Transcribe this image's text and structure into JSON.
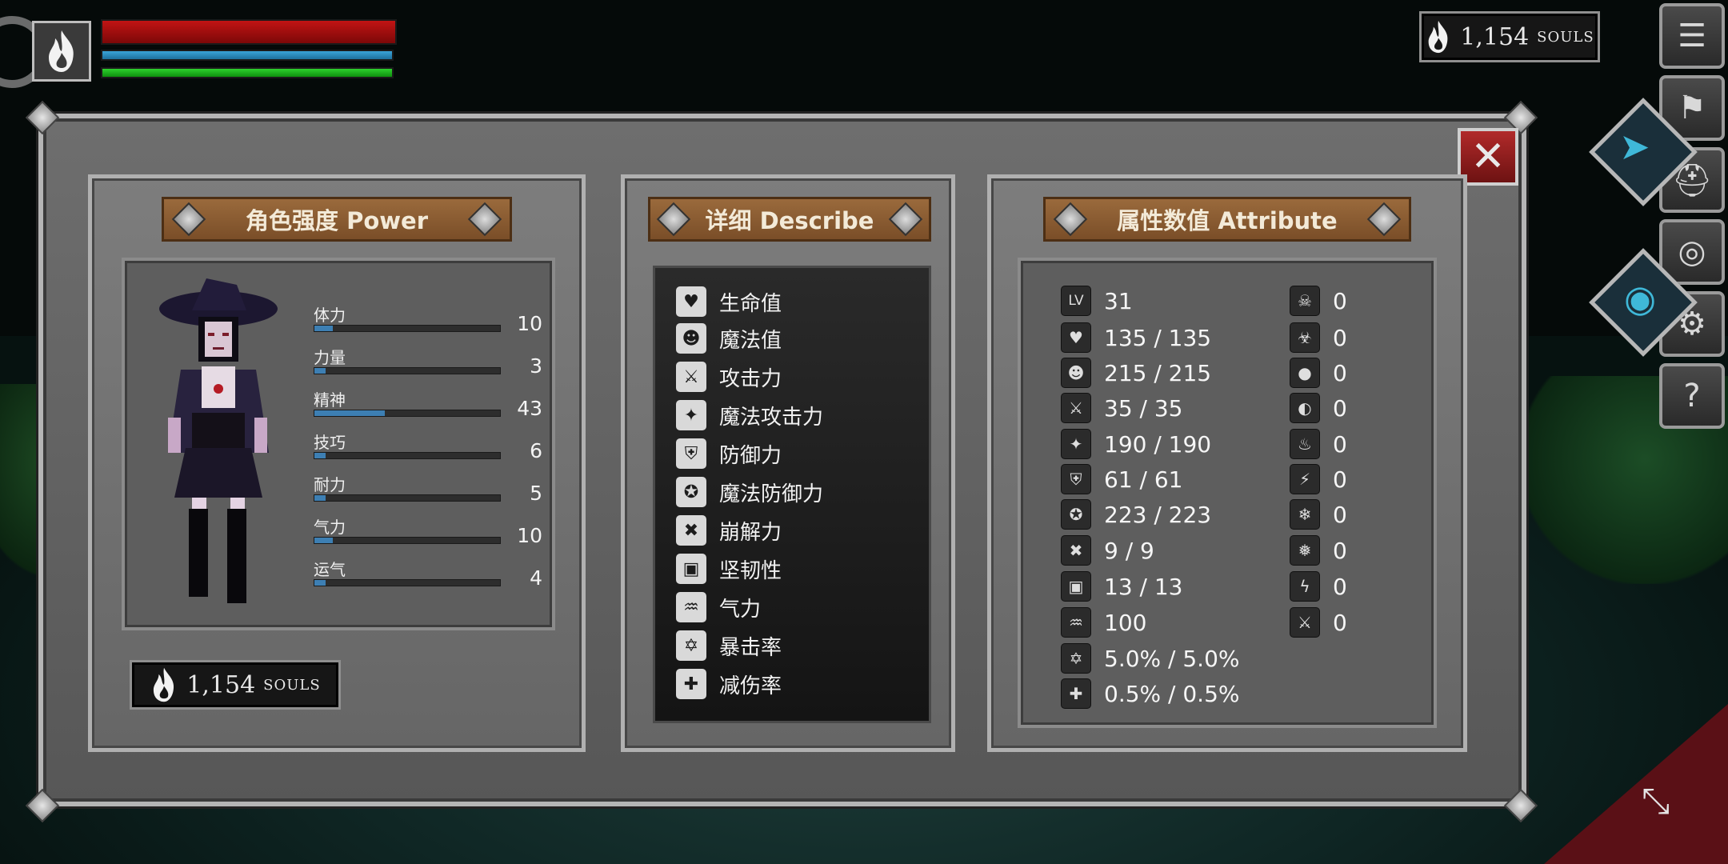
{
  "hud": {
    "souls_value": "1,154",
    "souls_label": "SOULS"
  },
  "power": {
    "title": "角色强度 Power",
    "stats": [
      {
        "name": "体力",
        "value": "10",
        "fill": 0.1
      },
      {
        "name": "力量",
        "value": "3",
        "fill": 0.03
      },
      {
        "name": "精神",
        "value": "43",
        "fill": 0.38
      },
      {
        "name": "技巧",
        "value": "6",
        "fill": 0.06
      },
      {
        "name": "耐力",
        "value": "5",
        "fill": 0.05
      },
      {
        "name": "气力",
        "value": "10",
        "fill": 0.1
      },
      {
        "name": "运气",
        "value": "4",
        "fill": 0.04
      }
    ],
    "souls_value": "1,154",
    "souls_label": "SOULS"
  },
  "describe": {
    "title": "详细 Describe",
    "items": [
      {
        "label": "生命值",
        "icon": "heart-icon",
        "glyph": "♥"
      },
      {
        "label": "魔法值",
        "icon": "head-icon",
        "glyph": "☻"
      },
      {
        "label": "攻击力",
        "icon": "sword-icon",
        "glyph": "⚔"
      },
      {
        "label": "魔法攻击力",
        "icon": "spellbook-icon",
        "glyph": "✦"
      },
      {
        "label": "防御力",
        "icon": "shield-icon",
        "glyph": "⛨"
      },
      {
        "label": "魔法防御力",
        "icon": "magic-shield-icon",
        "glyph": "✪"
      },
      {
        "label": "崩解力",
        "icon": "break-icon",
        "glyph": "✖"
      },
      {
        "label": "坚韧性",
        "icon": "helmet-icon",
        "glyph": "▣"
      },
      {
        "label": "气力",
        "icon": "lungs-icon",
        "glyph": "♒"
      },
      {
        "label": "暴击率",
        "icon": "critical-star-icon",
        "glyph": "✡"
      },
      {
        "label": "减伤率",
        "icon": "damage-reduction-icon",
        "glyph": "✚"
      }
    ]
  },
  "attribute": {
    "title": "属性数值 Attribute",
    "left": [
      {
        "icon": "level-icon",
        "glyph": "LV",
        "value": "31"
      },
      {
        "icon": "heart-icon",
        "glyph": "♥",
        "value": "135 / 135"
      },
      {
        "icon": "head-icon",
        "glyph": "☻",
        "value": "215 / 215"
      },
      {
        "icon": "sword-icon",
        "glyph": "⚔",
        "value": "35 / 35"
      },
      {
        "icon": "spellbook-icon",
        "glyph": "✦",
        "value": "190 / 190"
      },
      {
        "icon": "shield-icon",
        "glyph": "⛨",
        "value": "61 / 61"
      },
      {
        "icon": "magic-shield-icon",
        "glyph": "✪",
        "value": "223 / 223"
      },
      {
        "icon": "break-icon",
        "glyph": "✖",
        "value": "9 / 9"
      },
      {
        "icon": "helmet-icon",
        "glyph": "▣",
        "value": "13 / 13"
      },
      {
        "icon": "lungs-icon",
        "glyph": "♒",
        "value": "100"
      },
      {
        "icon": "critical-star-icon",
        "glyph": "✡",
        "value": "5.0% / 5.0%"
      },
      {
        "icon": "damage-reduction-icon",
        "glyph": "✚",
        "value": "0.5% / 0.5%"
      }
    ],
    "right": [
      {
        "icon": "poison-skull-icon",
        "glyph": "☠",
        "value": "0"
      },
      {
        "icon": "poison-resist-icon",
        "glyph": "☣",
        "value": "0"
      },
      {
        "icon": "bleed-drop-icon",
        "glyph": "●",
        "value": "0"
      },
      {
        "icon": "bleed-resist-icon",
        "glyph": "◐",
        "value": "0"
      },
      {
        "icon": "fire-icon",
        "glyph": "♨",
        "value": "0"
      },
      {
        "icon": "fire-resist-icon",
        "glyph": "⚡",
        "value": "0"
      },
      {
        "icon": "frost-icon",
        "glyph": "❄",
        "value": "0"
      },
      {
        "icon": "frost-resist-icon",
        "glyph": "❅",
        "value": "0"
      },
      {
        "icon": "lightning-icon",
        "glyph": "ϟ",
        "value": "0"
      },
      {
        "icon": "lightning-resist-icon",
        "glyph": "⚔",
        "value": "0"
      }
    ]
  },
  "side_menu": [
    {
      "icon": "menu-list-icon",
      "glyph": "☰"
    },
    {
      "icon": "backpack-icon",
      "glyph": "⚑"
    },
    {
      "icon": "helmet-icon",
      "glyph": "⛑"
    },
    {
      "icon": "soul-emblem-icon",
      "glyph": "◎"
    },
    {
      "icon": "gear-icon",
      "glyph": "⚙"
    },
    {
      "icon": "help-icon",
      "glyph": "?"
    }
  ]
}
